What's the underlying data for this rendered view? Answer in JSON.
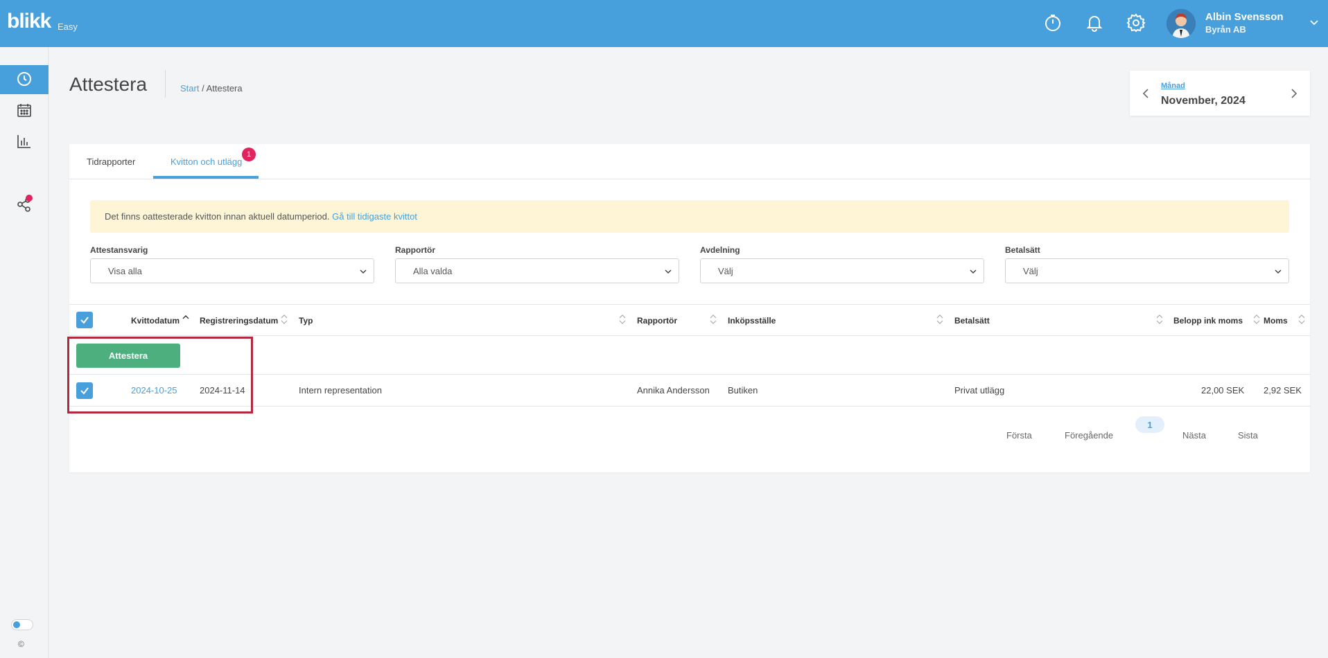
{
  "header": {
    "logo": "blikk",
    "logo_sub": "Easy",
    "icons": [
      "stopwatch-icon",
      "bell-icon",
      "gear-icon"
    ],
    "user_name": "Albin Svensson",
    "user_org": "Byrån AB"
  },
  "sidebar": {
    "items": [
      "clock-icon",
      "calendar-icon",
      "bar-chart-icon",
      "share-icon"
    ],
    "copyright": "©"
  },
  "page": {
    "title": "Attestera",
    "breadcrumb_start": "Start",
    "breadcrumb_sep": " / ",
    "breadcrumb_current": "Attestera"
  },
  "period": {
    "label": "Månad",
    "value": "November, 2024"
  },
  "tabs": {
    "items": [
      "Tidrapporter",
      "Kvitton och utlägg"
    ],
    "badge": "1"
  },
  "notice": {
    "text": "Det finns oattesterade kvitton innan aktuell datumperiod. ",
    "link": "Gå till tidigaste kvittot"
  },
  "filters": [
    {
      "label": "Attestansvarig",
      "value": "Visa alla"
    },
    {
      "label": "Rapportör",
      "value": "Alla valda"
    },
    {
      "label": "Avdelning",
      "value": "Välj"
    },
    {
      "label": "Betalsätt",
      "value": "Välj"
    }
  ],
  "table": {
    "columns": [
      "Kvittodatum",
      "Registreringsdatum",
      "Typ",
      "Rapportör",
      "Inköpsställe",
      "Betalsätt",
      "Belopp ink moms",
      "Moms"
    ],
    "action_button": "Attestera",
    "rows": [
      {
        "kvittodatum": "2024-10-25",
        "registreringsdatum": "2024-11-14",
        "typ": "Intern representation",
        "rapportor": "Annika Andersson",
        "inkopsstalle": "Butiken",
        "betalsatt": "Privat utlägg",
        "belopp": "22,00 SEK",
        "moms": "2,92 SEK"
      }
    ]
  },
  "pagination": {
    "first": "Första",
    "prev": "Föregående",
    "current": "1",
    "next": "Nästa",
    "last": "Sista"
  },
  "colors": {
    "brand": "#479fdb",
    "success": "#4caf7d",
    "badge": "#e0245e",
    "highlight": "#b3283d",
    "notice_bg": "#fdf5d6"
  }
}
